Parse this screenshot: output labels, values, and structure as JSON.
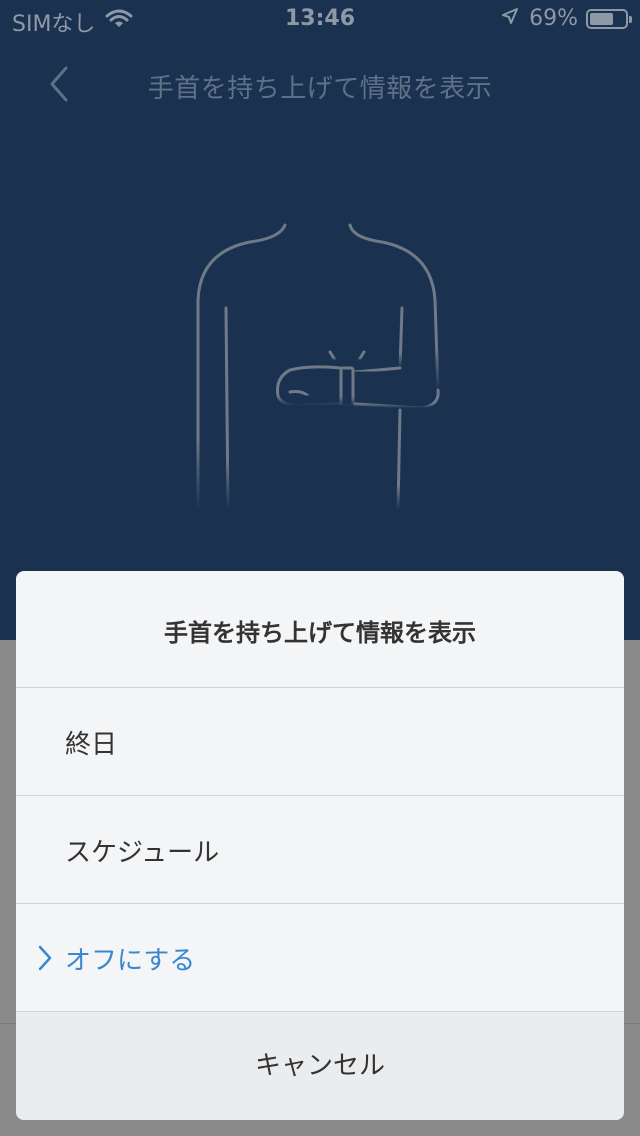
{
  "status_bar": {
    "carrier": "SIMなし",
    "time": "13:46",
    "battery_percent": "69%",
    "battery_level": 0.69,
    "icons": [
      "wifi-icon",
      "location-arrow-icon",
      "battery-icon"
    ]
  },
  "nav": {
    "title": "手首を持ち上げて情報を表示",
    "back_icon": "chevron-left-icon"
  },
  "illustration": {
    "icon": "wrist-raise-figure-icon"
  },
  "sheet": {
    "title": "手首を持ち上げて情報を表示",
    "options": [
      {
        "label": "終日",
        "selected": false
      },
      {
        "label": "スケジュール",
        "selected": false
      },
      {
        "label": "オフにする",
        "selected": true
      }
    ],
    "cancel_label": "キャンセル"
  },
  "colors": {
    "header_bg": "#1a3150",
    "accent": "#3a86d0",
    "sheet_bg": "#f4f5f7"
  }
}
